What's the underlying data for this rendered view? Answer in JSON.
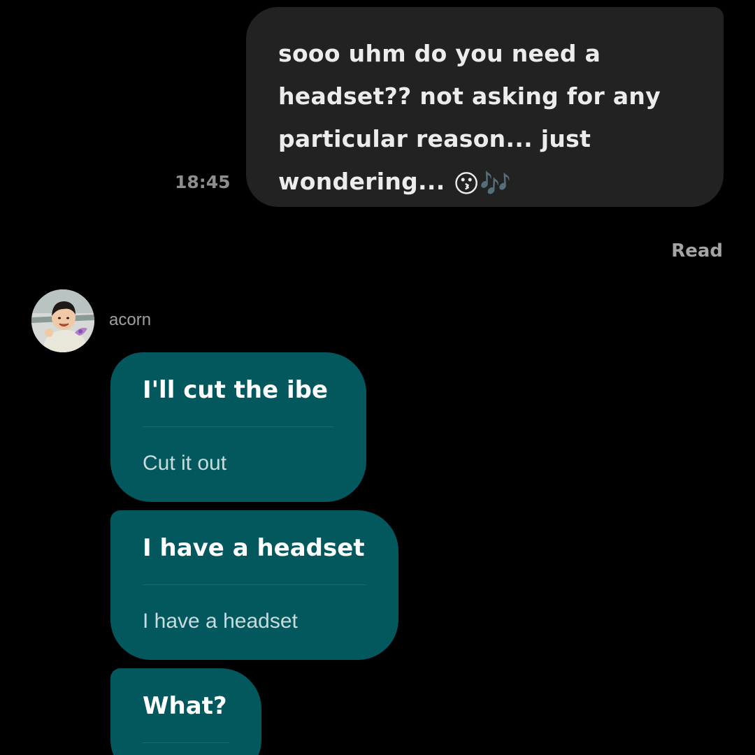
{
  "outgoing": {
    "text": "sooo uhm do you need a headset?? not asking for any particular reason... just wondering...",
    "lines": [
      "sooo uhm do you need a",
      "headset?? not asking for any",
      "particular reason... just",
      "wondering..."
    ],
    "emoji": [
      "😗",
      "🎶"
    ],
    "time": "18:45",
    "status": "Read"
  },
  "incoming": {
    "sender": "acorn",
    "avatar_icon": "profile-photo",
    "messages": [
      {
        "text": "I'll cut the ibe",
        "translation": "Cut it out"
      },
      {
        "text": "I have a headset",
        "translation": "I have a headset"
      },
      {
        "text": "What?",
        "translation": ""
      }
    ]
  },
  "colors": {
    "background": "#000000",
    "outgoing_bubble": "#222222",
    "incoming_bubble": "#03585E",
    "timestamp": "#8E8E8E",
    "read": "#A4A4A4"
  }
}
